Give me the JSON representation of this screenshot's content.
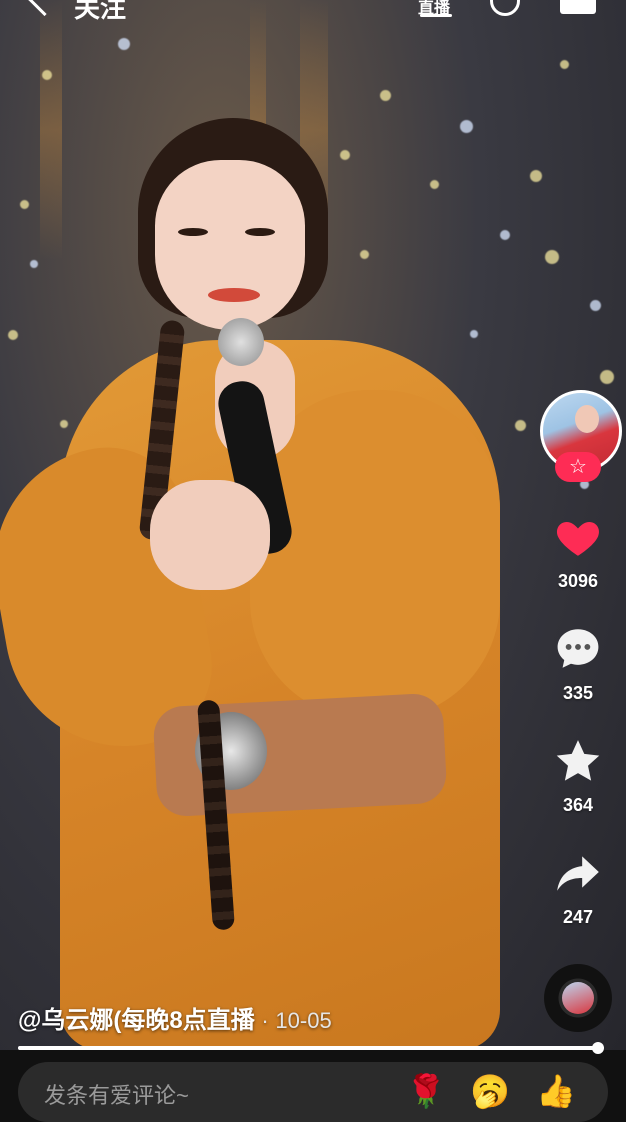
{
  "topbar": {
    "back_icon": "chevron-left-icon",
    "title": "关注",
    "live_label": "直播",
    "search_icon": "search-icon",
    "menu_icon": "menu-icon"
  },
  "actions": {
    "follow_icon": "star-icon",
    "likes": "3096",
    "comments": "335",
    "favorites": "364",
    "shares": "247",
    "like_color": "#fe2c55"
  },
  "caption": {
    "author": "@乌云娜(每晚8点直播",
    "separator": "·",
    "date": "10-05"
  },
  "progress": {
    "value": 0.99
  },
  "comment_bar": {
    "placeholder": "发条有爱评论~",
    "emojis": [
      "🌹",
      "🥱",
      "👍"
    ]
  }
}
